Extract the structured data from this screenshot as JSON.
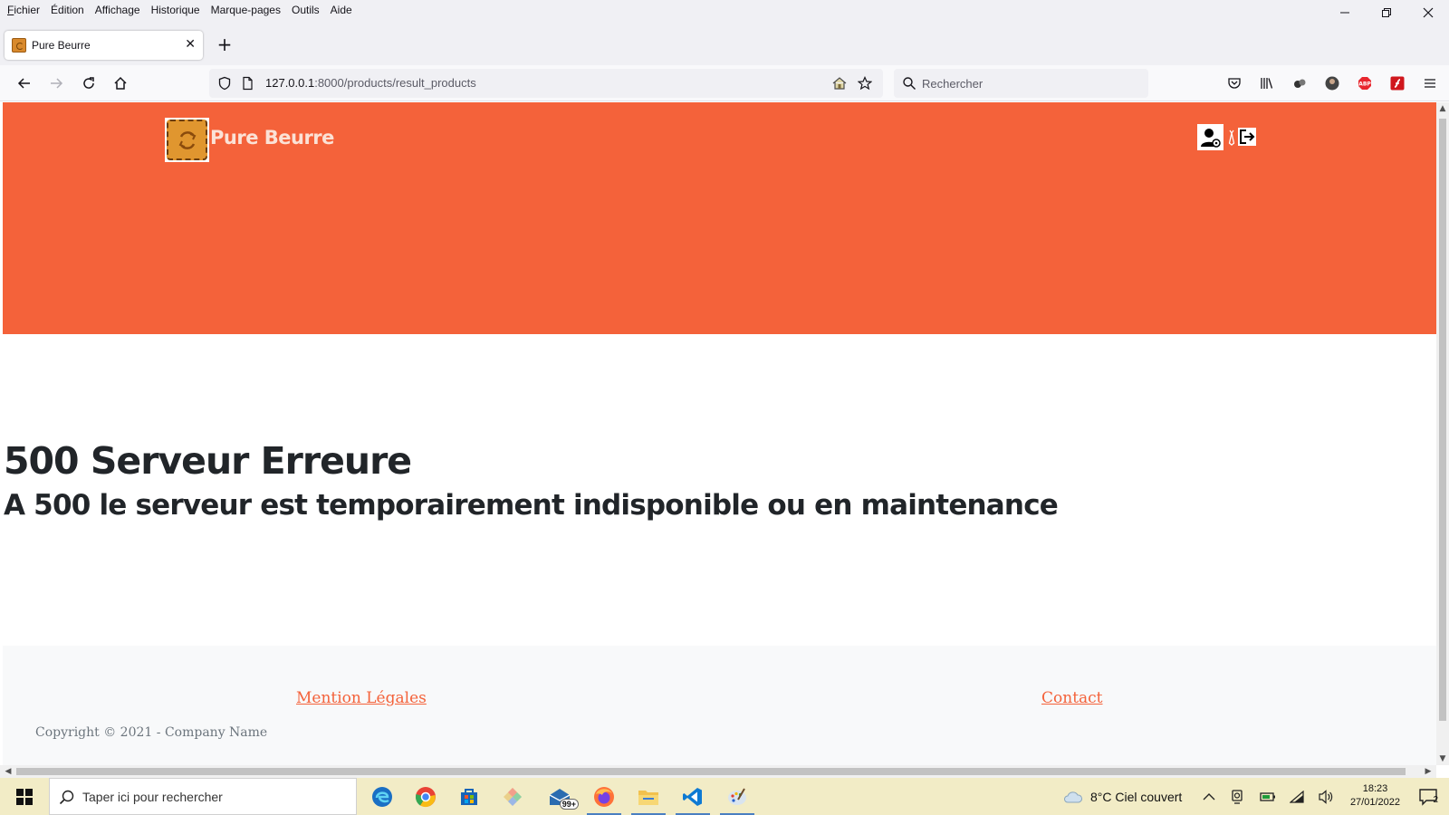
{
  "browser": {
    "menu": [
      "Fichier",
      "Édition",
      "Affichage",
      "Historique",
      "Marque-pages",
      "Outils",
      "Aide"
    ],
    "menu_access_keys": [
      "F",
      "É",
      "A",
      "H",
      "M",
      "O",
      "A"
    ],
    "tab_title": "Pure Beurre",
    "url_host": "127.0.0.1",
    "url_path": ":8000/products/result_products",
    "search_placeholder": "Rechercher"
  },
  "site": {
    "brand": "Pure Beurre",
    "accent_color": "#f4623a",
    "error_title": "500 Serveur Erreure",
    "error_message": "A 500 le serveur est temporairement indisponible ou en maintenance",
    "footer": {
      "legal_link": "Mention Légales",
      "contact_link": "Contact",
      "copyright": "Copyright © 2021 - Company Name"
    }
  },
  "taskbar": {
    "search_placeholder": "Taper ici pour rechercher",
    "mail_badge": "99+",
    "weather": "8°C  Ciel couvert",
    "time": "18:23",
    "date": "27/01/2022",
    "notification_count": "2"
  }
}
